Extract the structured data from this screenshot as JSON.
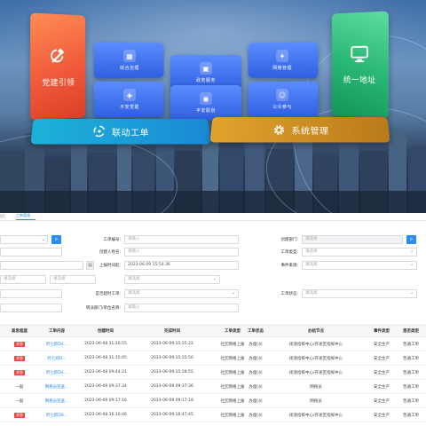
{
  "dashboard": {
    "party_building": "党建引领",
    "unified_address": "统一地址",
    "linked_work_order": "联动工单",
    "system_management": "系统管理",
    "modules": [
      {
        "label": "综合治理",
        "icon": "grid-icon"
      },
      {
        "label": "政务服务",
        "icon": "document-icon"
      },
      {
        "label": "网格管理",
        "icon": "network-icon"
      },
      {
        "label": "平安党建",
        "icon": "shield-icon"
      },
      {
        "label": "平安联创",
        "icon": "shield-check-icon"
      },
      {
        "label": "公众参与",
        "icon": "people-icon"
      }
    ]
  },
  "tabs": [
    "首页",
    "工单管理"
  ],
  "filters": {
    "work_order_no": {
      "label": "工单编号:",
      "placeholder": "请输入"
    },
    "creator_dept": {
      "label": "创建部门:",
      "placeholder": "请选择"
    },
    "creator_name": {
      "label": "创建人姓名:",
      "placeholder": "请输入"
    },
    "work_order_type": {
      "label": "工单类型:",
      "placeholder": "请选择"
    },
    "report_time": {
      "label": "上报时间起:",
      "value": "2023-06-09 15:54:36"
    },
    "event_source": {
      "label": "事件来源:",
      "placeholder": "请选择"
    },
    "left_select_1": {
      "placeholder": "请选择"
    },
    "left_select_2": {
      "placeholder": "请选择"
    },
    "timeout_flag": {
      "label": "是否超时工单:",
      "placeholder": "请选择"
    },
    "work_order_status": {
      "label": "工单状态:",
      "placeholder": "请选择"
    },
    "handler_dept": {
      "label": "转派部门/单位名称:",
      "placeholder": "请输入"
    }
  },
  "table": {
    "headers": [
      "紧急程度",
      "工单内容",
      "创建时间",
      "完成时间",
      "工单类型",
      "工单状态",
      "办结节点",
      "事件类型",
      "是否类型"
    ],
    "rows": [
      {
        "urgency": "紧急",
        "urgent": true,
        "content": "莳七跃D4...",
        "created": "2023-06-08 11:20:55",
        "finished": "2023-06-09 15:25:22",
        "type": "社区网格上报",
        "status": "办理(4)",
        "node": "街道指挥中心/开发区指挥中心",
        "event": "安全生产",
        "kind": "普通工单"
      },
      {
        "urgency": "紧急",
        "urgent": true,
        "content": "莳七跃D...",
        "created": "2023-06-08 11:15:45",
        "finished": "2023-06-09 15:25:50",
        "type": "社区网格上报",
        "status": "办理(4)",
        "node": "街道指挥中心/开发区指挥中心",
        "event": "安全生产",
        "kind": "普通工单"
      },
      {
        "urgency": "紧急",
        "urgent": true,
        "content": "莳七跃D4...",
        "created": "2023-06-08 09:44:21",
        "finished": "2023-06-09 15:28:55",
        "type": "社区网格上报",
        "status": "办理(4)",
        "node": "街道指挥中心/开发区指挥中心",
        "event": "安全生产",
        "kind": "普通工单"
      },
      {
        "urgency": "一般",
        "urgent": false,
        "content": "网格员巡查...",
        "created": "2023-06-09 09:37:34",
        "finished": "2023-06-09 09:37:36",
        "type": "社区网格上报",
        "status": "办理(4)",
        "node": "网格员",
        "event": "安全生产",
        "kind": "普通工单"
      },
      {
        "urgency": "一般",
        "urgent": false,
        "content": "网格员巡查...",
        "created": "2023-06-09 09:17:16",
        "finished": "2023-06-09 09:17:18",
        "type": "社区网格上报",
        "status": "办理(4)",
        "node": "网格员",
        "event": "安全生产",
        "kind": "普通工单"
      },
      {
        "urgency": "紧急",
        "urgent": true,
        "content": "莳七跃D8...",
        "created": "2023-06-08 16:10:46",
        "finished": "2023-06-09 16:47:45",
        "type": "社区网格上报",
        "status": "办理(4)",
        "node": "街道指挥中心/开发区指挥中心",
        "event": "安全生产",
        "kind": "普通工单"
      }
    ]
  },
  "colors": {
    "accent": "#2d8cf0",
    "urgent": "#e54545",
    "party_red": "#f05a3a",
    "address_green": "#27b574",
    "linked_blue": "#1a8ad6",
    "system_orange": "#d49224"
  }
}
